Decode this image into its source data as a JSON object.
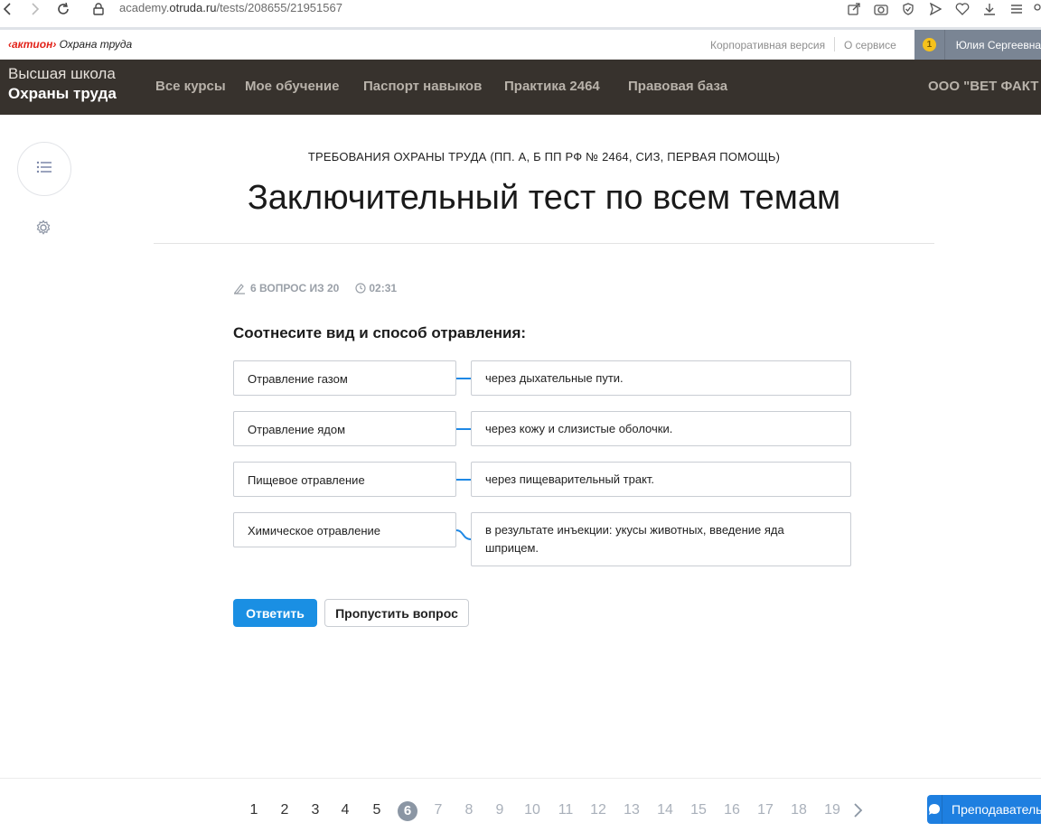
{
  "browser": {
    "url_prefix": "academy.",
    "url_domain": "otruda.ru",
    "url_path": "/tests/208655/21951567"
  },
  "topbar": {
    "logo_brand": "‹актион›",
    "logo_sub": "Охрана труда",
    "corporate_link": "Корпоративная версия",
    "about_link": "О сервисе",
    "notification_count": "1",
    "user_name": "Юлия Сергеевна"
  },
  "nav": {
    "school_line1": "Высшая школа",
    "school_line2": "Охраны труда",
    "items": [
      "Все курсы",
      "Мое обучение",
      "Паспорт навыков",
      "Практика 2464",
      "Правовая база"
    ],
    "org": "ООО \"ВЕТ ФАКТ"
  },
  "test": {
    "course": "ТРЕБОВАНИЯ ОХРАНЫ ТРУДА (ПП. А, Б ПП РФ № 2464, СИЗ, ПЕРВАЯ ПОМОЩЬ)",
    "title": "Заключительный тест по всем темам",
    "progress": "6 ВОПРОС ИЗ 20",
    "timer": "02:31",
    "question": "Соотнесите вид и способ отравления:",
    "pairs": [
      {
        "left": "Отравление газом",
        "right": "через дыхательные пути."
      },
      {
        "left": "Отравление ядом",
        "right": "через кожу и слизистые оболочки."
      },
      {
        "left": "Пищевое отравление",
        "right": "через пищеварительный тракт."
      },
      {
        "left": "Химическое отравление",
        "right": "в результате инъекции: укусы животных, введение яда шприцем."
      }
    ],
    "answer_button": "Ответить",
    "skip_button": "Пропустить вопрос"
  },
  "pagination": {
    "pages": [
      "1",
      "2",
      "3",
      "4",
      "5",
      "6",
      "7",
      "8",
      "9",
      "10",
      "11",
      "12",
      "13",
      "14",
      "15",
      "16",
      "17",
      "18",
      "19"
    ],
    "current": "6"
  },
  "teacher_button": "Преподаватель",
  "colors": {
    "accent": "#1a8fe3",
    "nav_bg": "#37322d",
    "brand_red": "#e2231a"
  }
}
